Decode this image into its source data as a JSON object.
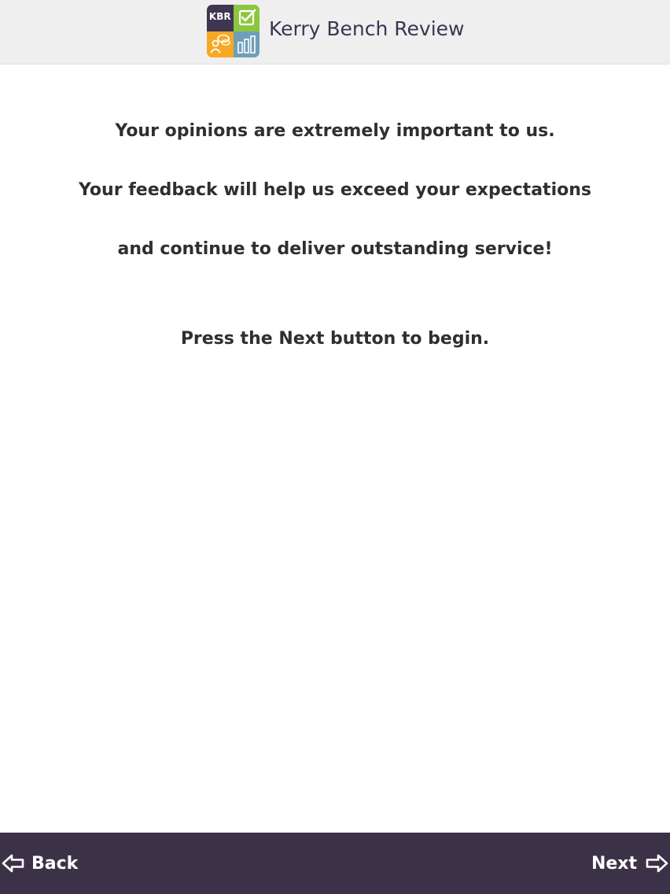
{
  "header": {
    "logo_text": "KBR",
    "app_title": "Kerry Bench Review",
    "logo_colors": {
      "top_left": "#3f3652",
      "top_right": "#8cc63f",
      "bottom_left": "#f7a823",
      "bottom_right": "#6f9fb8"
    },
    "logo_icons": [
      "checklist-icon",
      "chat-person-icon",
      "bar-chart-icon"
    ]
  },
  "intro": {
    "lines": [
      "Your opinions are extremely important to us.",
      "Your feedback will help us exceed your expectations",
      "and continue to deliver outstanding service!"
    ],
    "instruction": "Press the Next button to begin."
  },
  "footer": {
    "back_label": "Back",
    "next_label": "Next",
    "back_icon": "arrow-left-icon",
    "next_icon": "arrow-right-icon",
    "background": "#3b3247"
  }
}
